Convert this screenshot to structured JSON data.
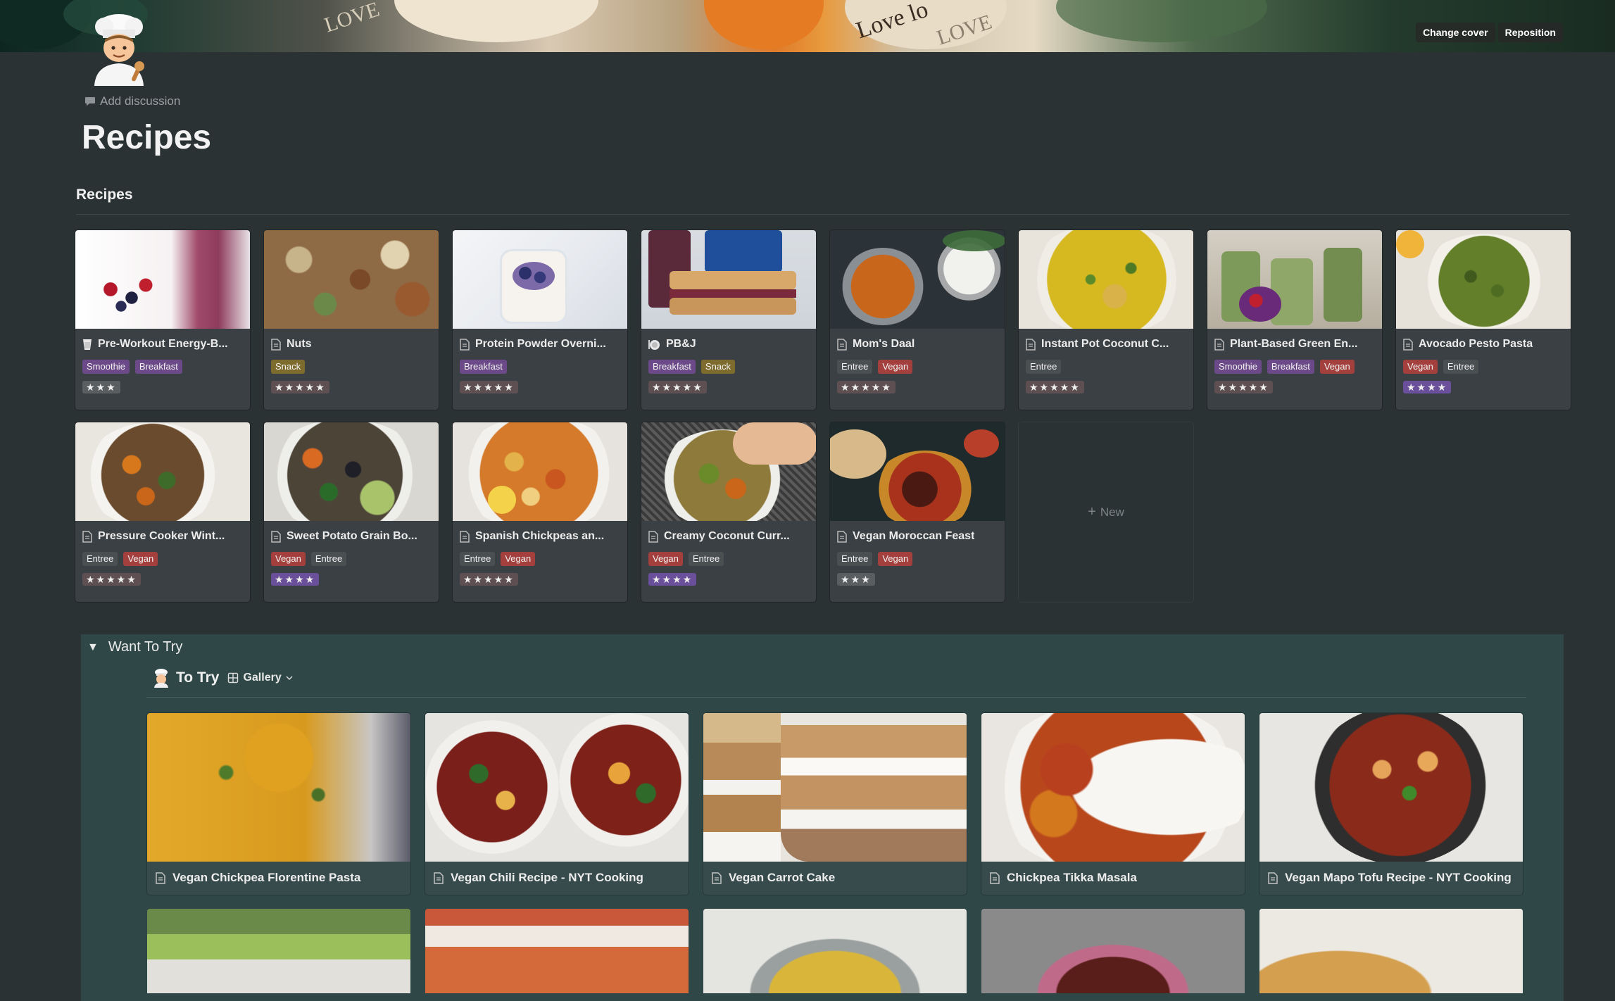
{
  "cover": {
    "change_cover": "Change cover",
    "reposition": "Reposition",
    "text_love_1": "LOVE",
    "text_love_2": "Love lo",
    "text_love_3": "LOVE"
  },
  "page": {
    "icon": "chef-emoji-icon",
    "add_discussion": "Add discussion",
    "title": "Recipes"
  },
  "recipes_section": {
    "title": "Recipes",
    "new_label": "New",
    "cards": [
      {
        "title": "Pre-Workout Energy-B...",
        "icon": "glass-icon",
        "tags": [
          {
            "label": "Smoothie",
            "color": "#6c4a8a"
          },
          {
            "label": "Breakfast",
            "color": "#6c4a8a"
          }
        ],
        "stars": "★★★",
        "stars_color": "#5b5e60",
        "rating": 3
      },
      {
        "title": "Nuts",
        "icon": "document-icon",
        "tags": [
          {
            "label": "Snack",
            "color": "#7e6c2e"
          }
        ],
        "stars": "★★★★★",
        "stars_color": "#5e5052",
        "rating": 5
      },
      {
        "title": "Protein Powder Overni...",
        "icon": "document-icon",
        "tags": [
          {
            "label": "Breakfast",
            "color": "#6c4a8a"
          }
        ],
        "stars": "★★★★★",
        "stars_color": "#5e5052",
        "rating": 5
      },
      {
        "title": "PB&J",
        "icon": "plate-icon",
        "tags": [
          {
            "label": "Breakfast",
            "color": "#6c4a8a"
          },
          {
            "label": "Snack",
            "color": "#7e6c2e"
          }
        ],
        "stars": "★★★★★",
        "stars_color": "#5e5052",
        "rating": 5
      },
      {
        "title": "Mom's Daal",
        "icon": "document-icon",
        "tags": [
          {
            "label": "Entree",
            "color": "#4a4f52"
          },
          {
            "label": "Vegan",
            "color": "#a3403d"
          }
        ],
        "stars": "★★★★★",
        "stars_color": "#5e5052",
        "rating": 5
      },
      {
        "title": "Instant Pot Coconut C...",
        "icon": "document-icon",
        "tags": [
          {
            "label": "Entree",
            "color": "#4a4f52"
          }
        ],
        "stars": "★★★★★",
        "stars_color": "#5e5052",
        "rating": 5
      },
      {
        "title": "Plant-Based Green En...",
        "icon": "document-icon",
        "tags": [
          {
            "label": "Smoothie",
            "color": "#6c4a8a"
          },
          {
            "label": "Breakfast",
            "color": "#6c4a8a"
          },
          {
            "label": "Vegan",
            "color": "#a3403d"
          }
        ],
        "stars": "★★★★★",
        "stars_color": "#5e5052",
        "rating": 5
      },
      {
        "title": "Avocado Pesto Pasta",
        "icon": "document-icon",
        "tags": [
          {
            "label": "Vegan",
            "color": "#a3403d"
          },
          {
            "label": "Entree",
            "color": "#4a4f52"
          }
        ],
        "stars": "★★★★",
        "stars_color": "#6a4f9a",
        "rating": 4
      },
      {
        "title": "Pressure Cooker Wint...",
        "icon": "document-icon",
        "tags": [
          {
            "label": "Entree",
            "color": "#4a4f52"
          },
          {
            "label": "Vegan",
            "color": "#a3403d"
          }
        ],
        "stars": "★★★★★",
        "stars_color": "#5e5052",
        "rating": 5
      },
      {
        "title": "Sweet Potato Grain Bo...",
        "icon": "document-icon",
        "tags": [
          {
            "label": "Vegan",
            "color": "#a3403d"
          },
          {
            "label": "Entree",
            "color": "#4a4f52"
          }
        ],
        "stars": "★★★★",
        "stars_color": "#6a4f9a",
        "rating": 4
      },
      {
        "title": "Spanish Chickpeas an...",
        "icon": "document-icon",
        "tags": [
          {
            "label": "Entree",
            "color": "#4a4f52"
          },
          {
            "label": "Vegan",
            "color": "#a3403d"
          }
        ],
        "stars": "★★★★★",
        "stars_color": "#5e5052",
        "rating": 5
      },
      {
        "title": "Creamy Coconut Curr...",
        "icon": "document-icon",
        "tags": [
          {
            "label": "Vegan",
            "color": "#a3403d"
          },
          {
            "label": "Entree",
            "color": "#4a4f52"
          }
        ],
        "stars": "★★★★",
        "stars_color": "#6a4f9a",
        "rating": 4
      },
      {
        "title": "Vegan Moroccan Feast",
        "icon": "document-icon",
        "tags": [
          {
            "label": "Entree",
            "color": "#4a4f52"
          },
          {
            "label": "Vegan",
            "color": "#a3403d"
          }
        ],
        "stars": "★★★",
        "stars_color": "#5b5e60",
        "rating": 3
      }
    ]
  },
  "want_to_try": {
    "toggle_label": "Want To Try",
    "view_icon": "chef-emoji-icon",
    "view_title": "To Try",
    "view_type": "Gallery",
    "cards": [
      {
        "title": "Vegan Chickpea Florentine Pasta"
      },
      {
        "title": "Vegan Chili Recipe - NYT Cooking"
      },
      {
        "title": "Vegan Carrot Cake"
      },
      {
        "title": "Chickpea Tikka Masala"
      },
      {
        "title": "Vegan Mapo Tofu Recipe - NYT Cooking"
      }
    ]
  }
}
